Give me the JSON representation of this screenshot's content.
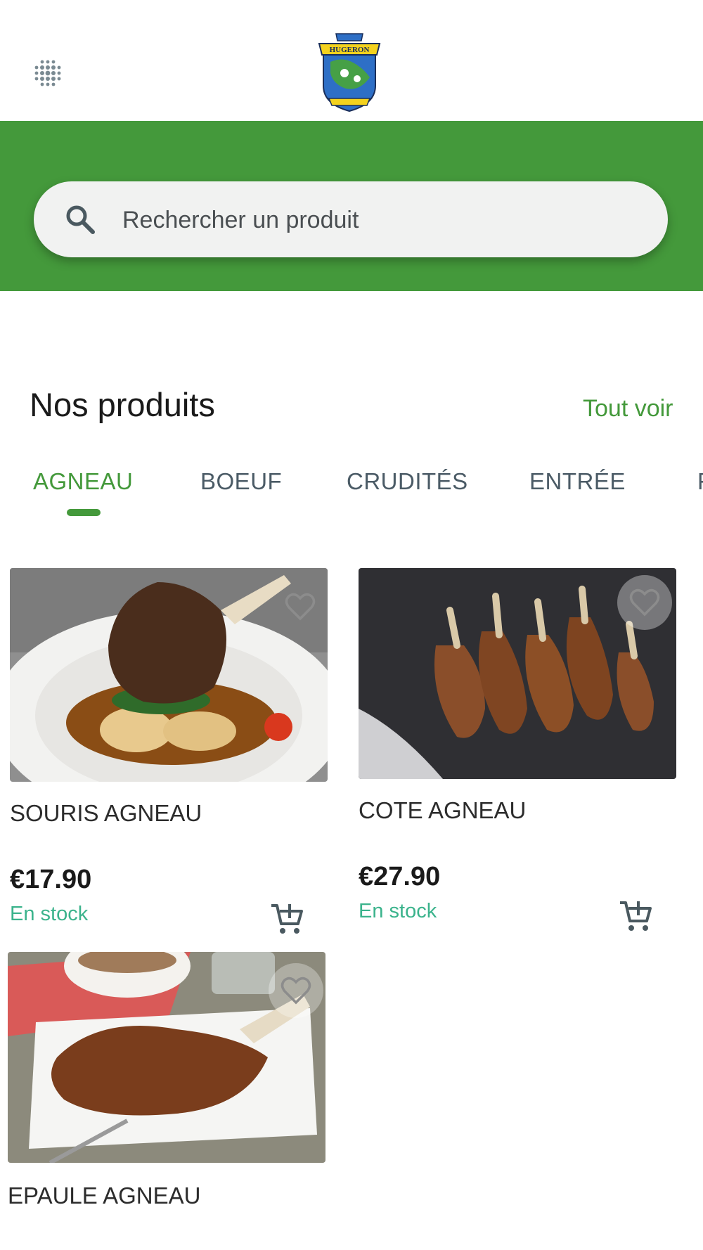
{
  "header": {
    "menu_icon": "grid-dots-icon",
    "logo_text": "HUGERON"
  },
  "search": {
    "placeholder": "Rechercher un produit",
    "icon": "search-icon"
  },
  "colors": {
    "brand_green": "#44993b",
    "stock_green": "#3bb38c",
    "tab_inactive": "#4b5b66"
  },
  "section": {
    "title": "Nos produits",
    "see_all": "Tout voir"
  },
  "tabs": [
    {
      "label": "AGNEAU",
      "active": true
    },
    {
      "label": "BOEUF",
      "active": false
    },
    {
      "label": "CRUDITÉS",
      "active": false
    },
    {
      "label": "ENTRÉE",
      "active": false
    }
  ],
  "products": [
    {
      "name": "SOURIS AGNEAU",
      "price": "€17.90",
      "stock": "En stock",
      "fav_icon": "heart-outline-icon",
      "cart_icon": "cart-add-icon"
    },
    {
      "name": "COTE AGNEAU",
      "price": "€27.90",
      "stock": "En stock",
      "fav_icon": "heart-outline-icon",
      "cart_icon": "cart-add-icon"
    },
    {
      "name": "EPAULE AGNEAU",
      "fav_icon": "heart-outline-icon"
    }
  ]
}
